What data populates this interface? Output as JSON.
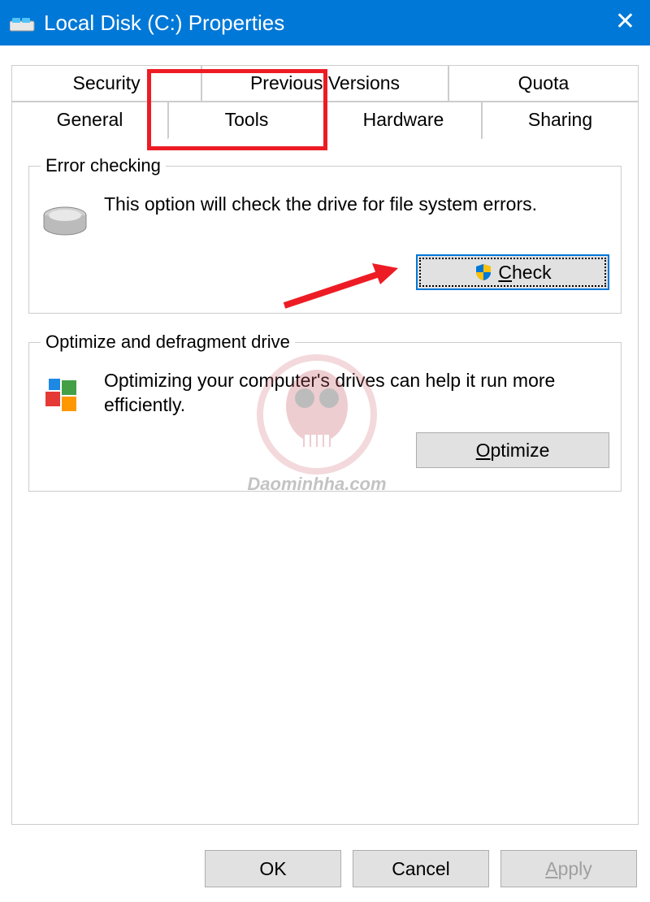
{
  "window": {
    "title": "Local Disk (C:) Properties"
  },
  "tabs": {
    "row1": [
      "Security",
      "Previous Versions",
      "Quota"
    ],
    "row2": [
      "General",
      "Tools",
      "Hardware",
      "Sharing"
    ],
    "active": "Tools"
  },
  "error_checking": {
    "legend": "Error checking",
    "description": "This option will check the drive for file system errors.",
    "button_prefix": "C",
    "button_rest": "heck"
  },
  "optimize": {
    "legend": "Optimize and defragment drive",
    "description": "Optimizing your computer's drives can help it run more efficiently.",
    "button_prefix": "O",
    "button_rest": "ptimize"
  },
  "buttons": {
    "ok": "OK",
    "cancel": "Cancel",
    "apply_prefix": "A",
    "apply_rest": "pply"
  },
  "watermark": "Daominhha.com"
}
